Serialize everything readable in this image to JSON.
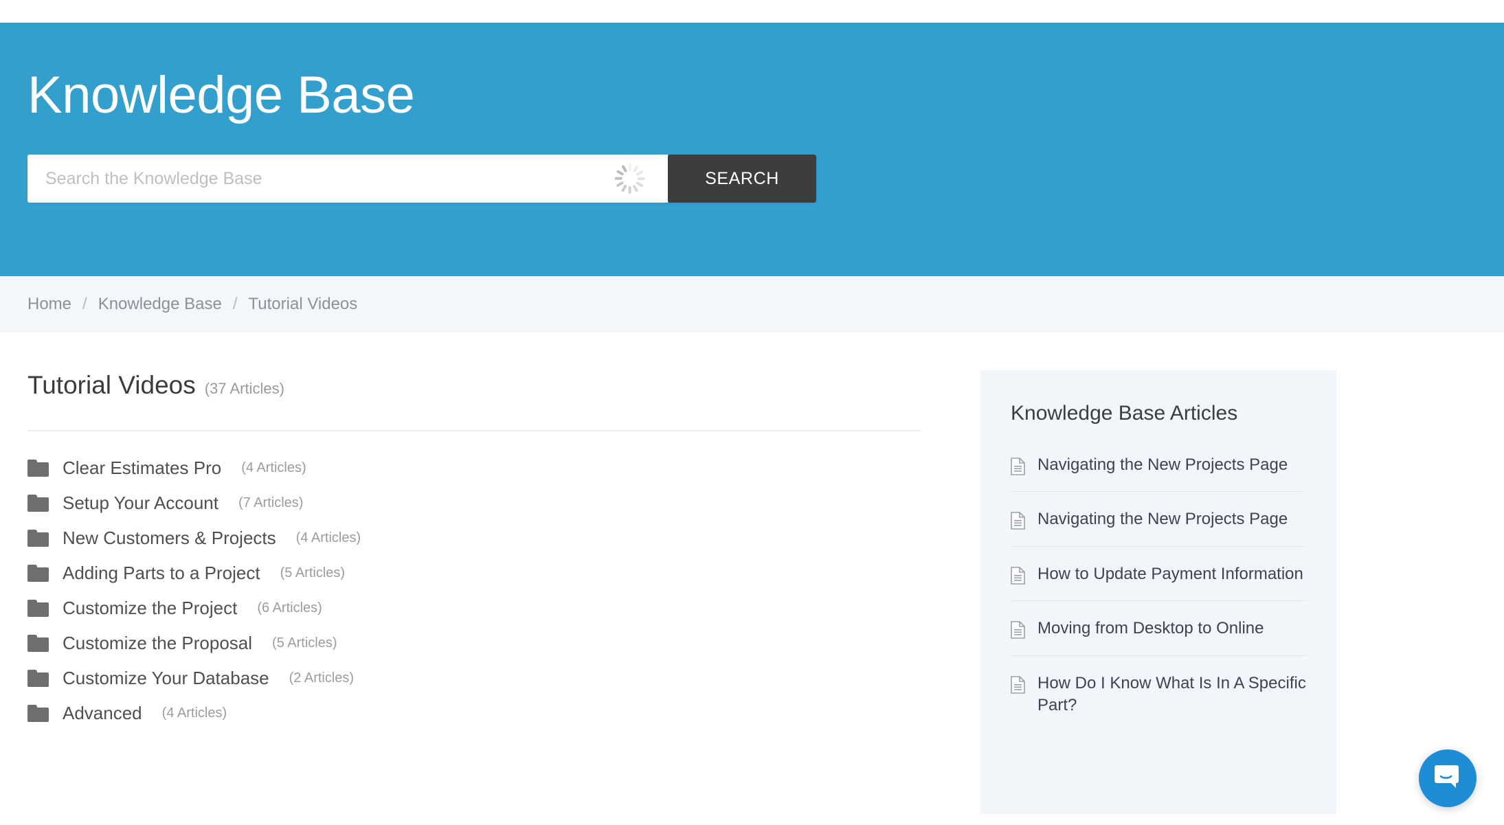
{
  "header": {
    "title": "Knowledge Base",
    "accent_color": "#339FCD",
    "search": {
      "placeholder": "Search the Knowledge Base",
      "value": "",
      "button_label": "SEARCH",
      "button_color": "#3d3d3d",
      "spinner_visible": true
    }
  },
  "breadcrumb": {
    "items": [
      {
        "label": "Home"
      },
      {
        "label": "Knowledge Base"
      },
      {
        "label": "Tutorial Videos"
      }
    ],
    "separator": "/",
    "background_color": "#F4F7FA"
  },
  "main": {
    "title": "Tutorial Videos",
    "count_label": "(37 Articles)",
    "folders": [
      {
        "label": "Clear Estimates Pro",
        "count_label": "(4 Articles)"
      },
      {
        "label": "Setup Your Account",
        "count_label": "(7 Articles)"
      },
      {
        "label": "New Customers & Projects",
        "count_label": "(4 Articles)"
      },
      {
        "label": "Adding Parts to a Project",
        "count_label": "(5 Articles)"
      },
      {
        "label": "Customize the Project",
        "count_label": "(6 Articles)"
      },
      {
        "label": "Customize the Proposal",
        "count_label": "(5 Articles)"
      },
      {
        "label": "Customize Your Database",
        "count_label": "(2 Articles)"
      },
      {
        "label": "Advanced",
        "count_label": "(4 Articles)"
      }
    ]
  },
  "sidebar": {
    "title": "Knowledge Base Articles",
    "background_color": "#F2F6FA",
    "articles": [
      {
        "label": "Navigating the New Projects Page"
      },
      {
        "label": "Navigating the New Projects Page"
      },
      {
        "label": "How to Update Payment Information"
      },
      {
        "label": "Moving from Desktop to Online"
      },
      {
        "label": "How Do I Know What Is In A Specific Part?"
      }
    ]
  },
  "messenger": {
    "launcher_color": "#1F8DD6",
    "icon": "chat-bubble-smile-icon"
  }
}
